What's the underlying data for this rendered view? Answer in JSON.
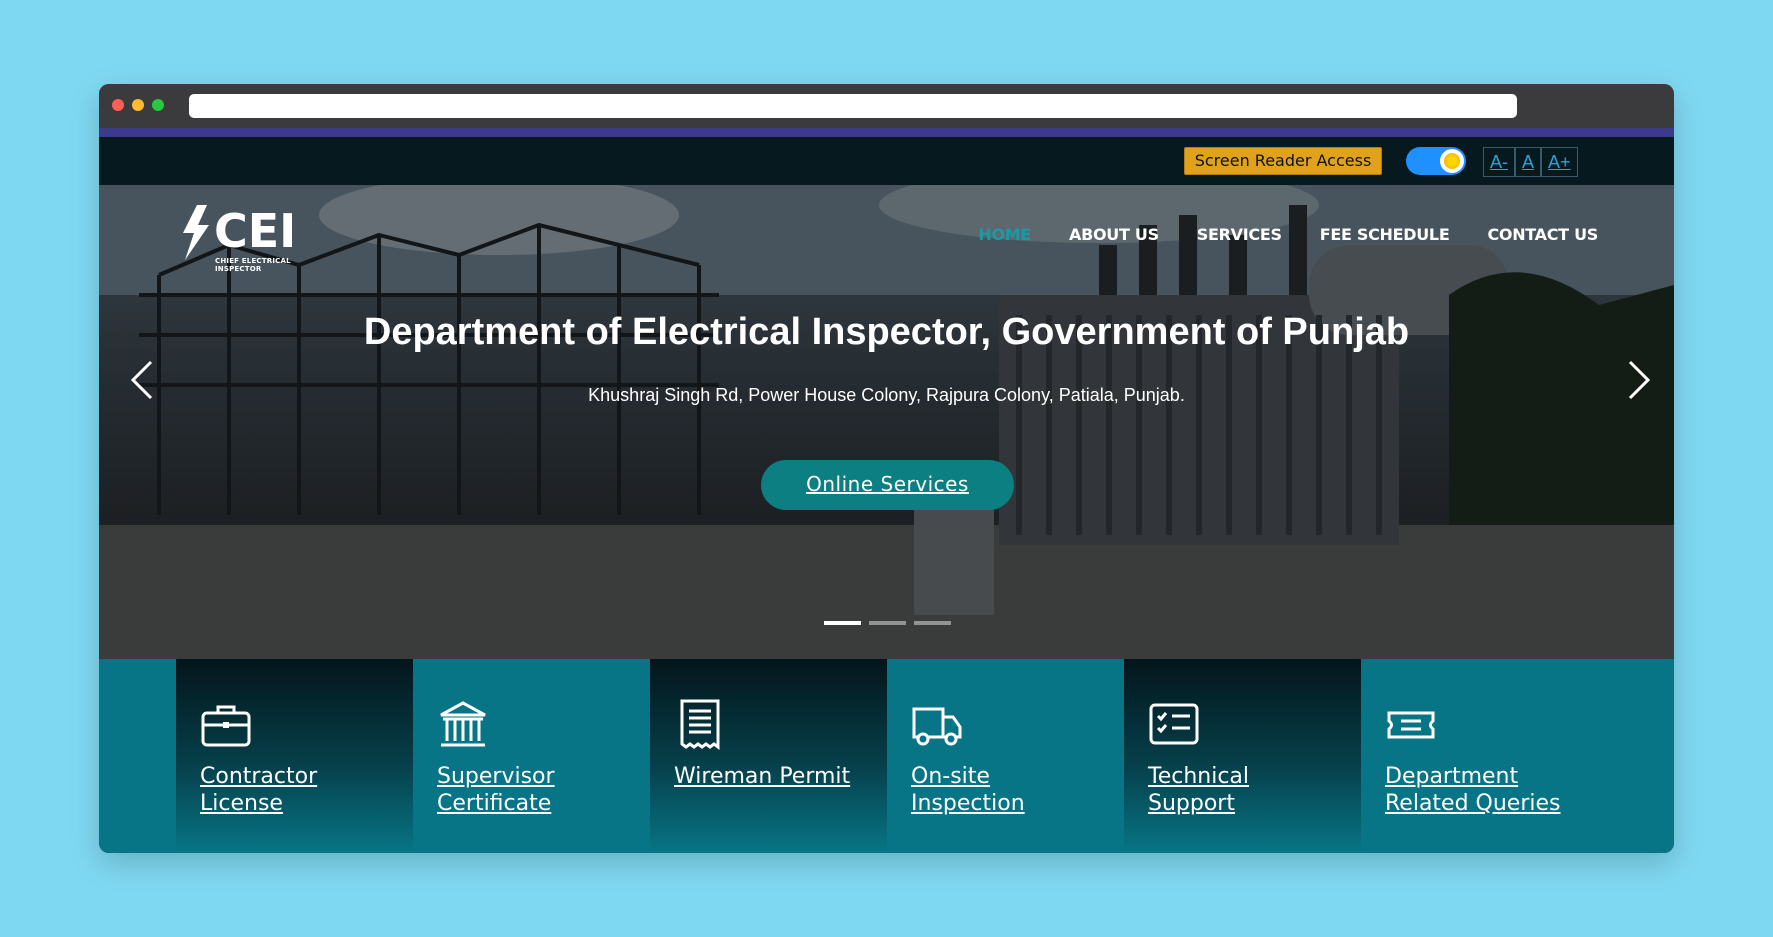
{
  "topbar": {
    "screen_reader_label": "Screen Reader Access",
    "font_decrease": "A-",
    "font_normal": "A",
    "font_increase": "A+"
  },
  "logo": {
    "text": "CEI",
    "subtitle": "CHIEF ELECTRICAL INSPECTOR"
  },
  "nav": {
    "items": [
      {
        "label": "HOME",
        "active": true
      },
      {
        "label": "ABOUT US"
      },
      {
        "label": "SERVICES"
      },
      {
        "label": "FEE SCHEDULE"
      },
      {
        "label": "CONTACT US"
      }
    ]
  },
  "hero": {
    "title": "Department of Electrical Inspector, Government of Punjab",
    "address": "Khushraj Singh Rd, Power House Colony, Rajpura Colony, Patiala, Punjab.",
    "cta_label": "Online Services",
    "slide_count": 3,
    "active_slide": 1
  },
  "cards": [
    {
      "label": "Contractor License",
      "icon": "briefcase-icon"
    },
    {
      "label": "Supervisor Certificate",
      "icon": "institution-icon"
    },
    {
      "label": "Wireman Permit",
      "icon": "receipt-icon"
    },
    {
      "label": "On-site Inspection",
      "icon": "truck-icon"
    },
    {
      "label": "Technical Support",
      "icon": "checklist-icon"
    },
    {
      "label": "Department Related Queries",
      "icon": "ticket-icon"
    }
  ],
  "colors": {
    "background": "#7fd8f1",
    "accent_teal": "#0b7f82",
    "nav_active": "#1b9aa5",
    "screen_reader_button": "#e0a21a",
    "toggle": "#1e90ff"
  }
}
